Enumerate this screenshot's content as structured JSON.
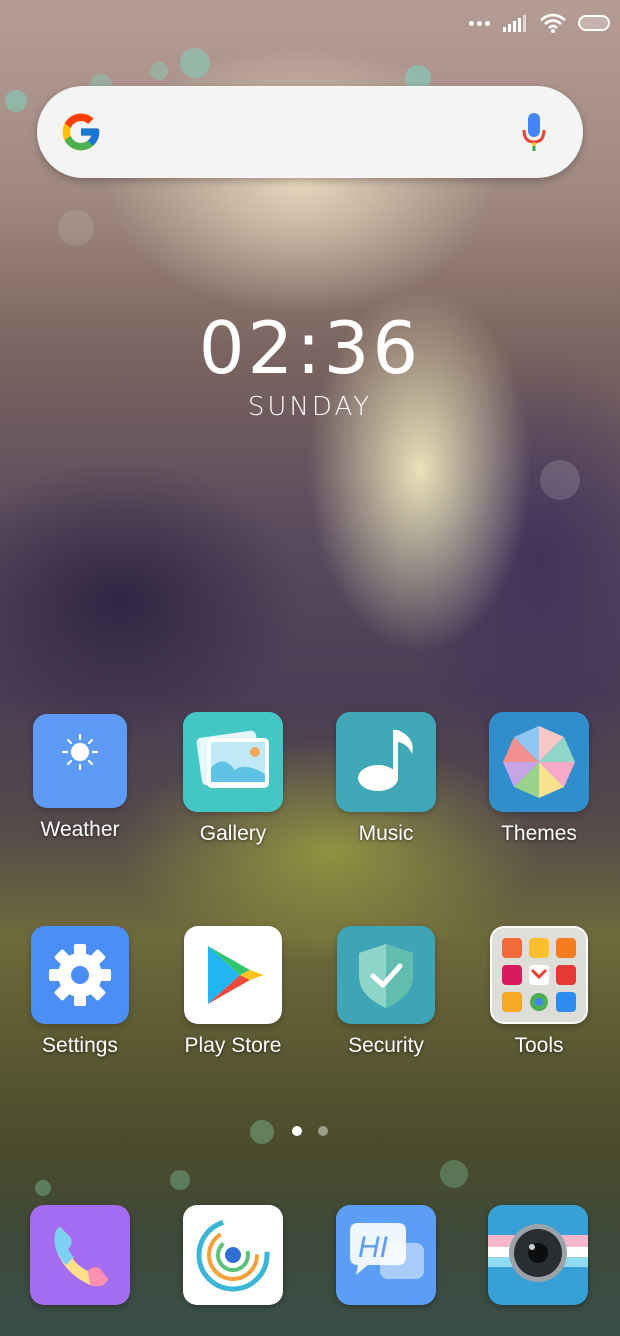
{
  "status_bar": {
    "signal_icon": "signal-bars-icon",
    "wifi_icon": "wifi-icon",
    "battery_icon": "battery-icon"
  },
  "search": {
    "logo_icon": "google-logo-icon",
    "mic_icon": "microphone-icon"
  },
  "clock": {
    "time": "02:36",
    "day": "SUNDAY"
  },
  "apps": [
    {
      "label": "Weather",
      "icon": "weather-sun-icon",
      "color": "#5b9af7"
    },
    {
      "label": "Gallery",
      "icon": "gallery-icon",
      "color": "#3fc4c4"
    },
    {
      "label": "Music",
      "icon": "music-note-icon",
      "color": "#3fa8b8"
    },
    {
      "label": "Themes",
      "icon": "themes-umbrella-icon",
      "color": "#2e8fc9"
    },
    {
      "label": "Settings",
      "icon": "gear-icon",
      "color": "#4a8ff5"
    },
    {
      "label": "Play Store",
      "icon": "play-store-icon",
      "color": "#ffffff"
    },
    {
      "label": "Security",
      "icon": "shield-check-icon",
      "color": "#3fa8b8"
    },
    {
      "label": "Tools",
      "icon": "folder-tools-icon",
      "color": "#e9e9e9"
    }
  ],
  "page_indicator": {
    "pages": 2,
    "active": 1
  },
  "dock": [
    {
      "icon": "phone-icon",
      "color": "#a46cf0"
    },
    {
      "icon": "browser-icon",
      "color": "#ffffff"
    },
    {
      "icon": "messages-icon",
      "color": "#5a9cf5"
    },
    {
      "icon": "camera-icon",
      "color": "#37a0d6"
    }
  ]
}
